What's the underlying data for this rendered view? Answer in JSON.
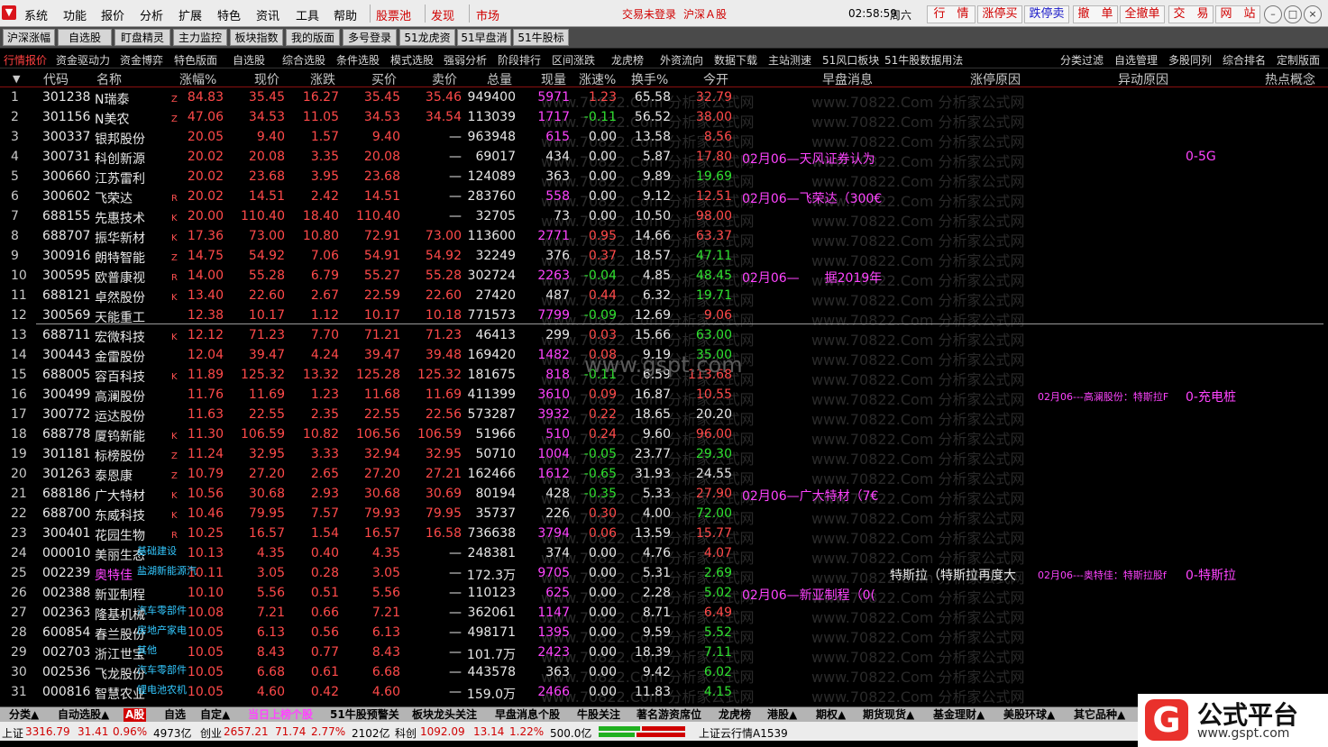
{
  "menu": {
    "items": [
      "系统",
      "功能",
      "报价",
      "分析",
      "扩展",
      "特色",
      "资讯",
      "工具",
      "帮助"
    ],
    "stock_pool": "股票池",
    "discover": "发现",
    "market": "市场",
    "login_status": "交易未登录",
    "market_name": "沪深Ａ股",
    "time": "02:58:59",
    "weekday": "周六",
    "quick_buttons": [
      "行　情",
      "涨停买",
      "跌停卖",
      "撤　单",
      "全撤单",
      "交　易",
      "网　站"
    ],
    "win_min": "–",
    "win_restore": "□",
    "win_close": "×"
  },
  "toolbar": [
    "沪深涨幅",
    "自选股",
    "盯盘精灵",
    "主力监控",
    "板块指数",
    "我的版面",
    "多号登录",
    "51龙虎资金",
    "51早盘消息",
    "51牛股标签"
  ],
  "subtabs": [
    "行情报价",
    "资金驱动力",
    "资金博弈",
    "特色版面",
    "自选股",
    "综合选股",
    "条件选股",
    "模式选股",
    "强弱分析",
    "阶段排行",
    "区间涨跌",
    "龙虎榜",
    "外资流向",
    "数据下载",
    "主站测速",
    "51风口板块",
    "51牛股数据用法",
    "分类过滤",
    "自选管理",
    "多股同列",
    "综合排名",
    "定制版面"
  ],
  "columns": [
    "代码",
    "名称",
    "涨幅%",
    "现价",
    "涨跌",
    "买价",
    "卖价",
    "总量",
    "现量",
    "涨速%",
    "换手%",
    "今开",
    "早盘消息",
    "涨停原因",
    "异动原因",
    "热点概念"
  ],
  "rows": [
    {
      "idx": "1",
      "code": "301238",
      "name": "N瑞泰",
      "flag": "Z",
      "chg_pct": "84.83",
      "price": "35.45",
      "chg": "16.27",
      "bid": "35.45",
      "ask": "35.46",
      "vol": "949400",
      "cur": "5971",
      "cur_c": "mag",
      "speed": "1.23",
      "speed_c": "red",
      "turn": "65.58",
      "open": "32.79",
      "open_c": "red"
    },
    {
      "idx": "2",
      "code": "301156",
      "name": "N美农",
      "flag": "Z",
      "chg_pct": "47.06",
      "price": "34.53",
      "chg": "11.05",
      "bid": "34.53",
      "ask": "34.54",
      "vol": "113039",
      "cur": "1717",
      "cur_c": "mag",
      "speed": "-0.11",
      "speed_c": "green",
      "turn": "56.52",
      "open": "38.00",
      "open_c": "red"
    },
    {
      "idx": "3",
      "code": "300337",
      "name": "银邦股份",
      "flag": "",
      "chg_pct": "20.05",
      "price": "9.40",
      "chg": "1.57",
      "bid": "9.40",
      "ask": "—",
      "vol": "963948",
      "cur": "615",
      "cur_c": "mag",
      "speed": "0.00",
      "speed_c": "white",
      "turn": "13.58",
      "open": "8.56",
      "open_c": "red"
    },
    {
      "idx": "4",
      "code": "300731",
      "name": "科创新源",
      "flag": "",
      "chg_pct": "20.02",
      "price": "20.08",
      "chg": "3.35",
      "bid": "20.08",
      "ask": "—",
      "vol": "69017",
      "cur": "434",
      "cur_c": "white",
      "speed": "0.00",
      "speed_c": "white",
      "turn": "5.87",
      "open": "17.80",
      "open_c": "red",
      "news": "02月06—天风证券认为",
      "concept": "0-5G"
    },
    {
      "idx": "5",
      "code": "300660",
      "name": "江苏雷利",
      "flag": "",
      "chg_pct": "20.02",
      "price": "23.68",
      "chg": "3.95",
      "bid": "23.68",
      "ask": "—",
      "vol": "124089",
      "cur": "363",
      "cur_c": "white",
      "speed": "0.00",
      "speed_c": "white",
      "turn": "9.89",
      "open": "19.69",
      "open_c": "green"
    },
    {
      "idx": "6",
      "code": "300602",
      "name": "飞荣达",
      "flag": "R",
      "chg_pct": "20.02",
      "price": "14.51",
      "chg": "2.42",
      "bid": "14.51",
      "ask": "—",
      "vol": "283760",
      "cur": "558",
      "cur_c": "mag",
      "speed": "0.00",
      "speed_c": "white",
      "turn": "9.12",
      "open": "12.51",
      "open_c": "red",
      "news": "02月06—飞荣达（300€"
    },
    {
      "idx": "7",
      "code": "688155",
      "name": "先惠技术",
      "flag": "K",
      "chg_pct": "20.00",
      "price": "110.40",
      "chg": "18.40",
      "bid": "110.40",
      "ask": "—",
      "vol": "32705",
      "cur": "73",
      "cur_c": "white",
      "speed": "0.00",
      "speed_c": "white",
      "turn": "10.50",
      "open": "98.00",
      "open_c": "red"
    },
    {
      "idx": "8",
      "code": "688707",
      "name": "振华新材",
      "flag": "K",
      "chg_pct": "17.36",
      "price": "73.00",
      "chg": "10.80",
      "bid": "72.91",
      "ask": "73.00",
      "vol": "113600",
      "cur": "2771",
      "cur_c": "mag",
      "speed": "0.95",
      "speed_c": "red",
      "turn": "14.66",
      "open": "63.37",
      "open_c": "red"
    },
    {
      "idx": "9",
      "code": "300916",
      "name": "朗特智能",
      "flag": "Z",
      "chg_pct": "14.75",
      "price": "54.92",
      "chg": "7.06",
      "bid": "54.91",
      "ask": "54.92",
      "vol": "32249",
      "cur": "376",
      "cur_c": "white",
      "speed": "0.37",
      "speed_c": "red",
      "turn": "18.57",
      "open": "47.11",
      "open_c": "green"
    },
    {
      "idx": "10",
      "code": "300595",
      "name": "欧普康视",
      "flag": "R",
      "chg_pct": "14.00",
      "price": "55.28",
      "chg": "6.79",
      "bid": "55.27",
      "ask": "55.28",
      "vol": "302724",
      "cur": "2263",
      "cur_c": "mag",
      "speed": "-0.04",
      "speed_c": "green",
      "turn": "4.85",
      "open": "48.45",
      "open_c": "green",
      "news": "02月06—　　据2019年"
    },
    {
      "idx": "11",
      "code": "688121",
      "name": "卓然股份",
      "flag": "K",
      "chg_pct": "13.40",
      "price": "22.60",
      "chg": "2.67",
      "bid": "22.59",
      "ask": "22.60",
      "vol": "27420",
      "cur": "487",
      "cur_c": "white",
      "speed": "0.44",
      "speed_c": "red",
      "turn": "6.32",
      "open": "19.71",
      "open_c": "green"
    },
    {
      "idx": "12",
      "code": "300569",
      "name": "天能重工",
      "flag": "",
      "chg_pct": "12.38",
      "price": "10.17",
      "chg": "1.12",
      "bid": "10.17",
      "ask": "10.18",
      "vol": "771573",
      "cur": "7799",
      "cur_c": "mag",
      "speed": "-0.09",
      "speed_c": "green",
      "turn": "12.69",
      "open": "9.06",
      "open_c": "red"
    },
    {
      "idx": "13",
      "code": "688711",
      "name": "宏微科技",
      "flag": "K",
      "chg_pct": "12.12",
      "price": "71.23",
      "chg": "7.70",
      "bid": "71.21",
      "ask": "71.23",
      "vol": "46413",
      "cur": "299",
      "cur_c": "white",
      "speed": "0.03",
      "speed_c": "red",
      "turn": "15.66",
      "open": "63.00",
      "open_c": "green"
    },
    {
      "idx": "14",
      "code": "300443",
      "name": "金雷股份",
      "flag": "",
      "chg_pct": "12.04",
      "price": "39.47",
      "chg": "4.24",
      "bid": "39.47",
      "ask": "39.48",
      "vol": "169420",
      "cur": "1482",
      "cur_c": "mag",
      "speed": "0.08",
      "speed_c": "red",
      "turn": "9.19",
      "open": "35.00",
      "open_c": "green"
    },
    {
      "idx": "15",
      "code": "688005",
      "name": "容百科技",
      "flag": "K",
      "chg_pct": "11.89",
      "price": "125.32",
      "chg": "13.32",
      "bid": "125.28",
      "ask": "125.32",
      "vol": "181675",
      "cur": "818",
      "cur_c": "mag",
      "speed": "-0.11",
      "speed_c": "green",
      "turn": "6.59",
      "open": "113.68",
      "open_c": "red"
    },
    {
      "idx": "16",
      "code": "300499",
      "name": "高澜股份",
      "flag": "",
      "chg_pct": "11.76",
      "price": "11.69",
      "chg": "1.23",
      "bid": "11.68",
      "ask": "11.69",
      "vol": "411399",
      "cur": "3610",
      "cur_c": "mag",
      "speed": "0.09",
      "speed_c": "red",
      "turn": "16.87",
      "open": "10.55",
      "open_c": "red",
      "anomaly": "02月06---高澜股份：特斯拉F",
      "concept": "0-充电桩"
    },
    {
      "idx": "17",
      "code": "300772",
      "name": "运达股份",
      "flag": "",
      "chg_pct": "11.63",
      "price": "22.55",
      "chg": "2.35",
      "bid": "22.55",
      "ask": "22.56",
      "vol": "573287",
      "cur": "3932",
      "cur_c": "mag",
      "speed": "0.22",
      "speed_c": "red",
      "turn": "18.65",
      "open": "20.20",
      "open_c": "white"
    },
    {
      "idx": "18",
      "code": "688778",
      "name": "厦钨新能",
      "flag": "K",
      "chg_pct": "11.30",
      "price": "106.59",
      "chg": "10.82",
      "bid": "106.56",
      "ask": "106.59",
      "vol": "51966",
      "cur": "510",
      "cur_c": "mag",
      "speed": "0.24",
      "speed_c": "red",
      "turn": "9.60",
      "open": "96.00",
      "open_c": "red"
    },
    {
      "idx": "19",
      "code": "301181",
      "name": "标榜股份",
      "flag": "Z",
      "chg_pct": "11.24",
      "price": "32.95",
      "chg": "3.33",
      "bid": "32.94",
      "ask": "32.95",
      "vol": "50710",
      "cur": "1004",
      "cur_c": "mag",
      "speed": "-0.05",
      "speed_c": "green",
      "turn": "23.77",
      "open": "29.30",
      "open_c": "green"
    },
    {
      "idx": "20",
      "code": "301263",
      "name": "泰恩康",
      "flag": "Z",
      "chg_pct": "10.79",
      "price": "27.20",
      "chg": "2.65",
      "bid": "27.20",
      "ask": "27.21",
      "vol": "162466",
      "cur": "1612",
      "cur_c": "mag",
      "speed": "-0.65",
      "speed_c": "green",
      "turn": "31.93",
      "open": "24.55",
      "open_c": "white"
    },
    {
      "idx": "21",
      "code": "688186",
      "name": "广大特材",
      "flag": "K",
      "chg_pct": "10.56",
      "price": "30.68",
      "chg": "2.93",
      "bid": "30.68",
      "ask": "30.69",
      "vol": "80194",
      "cur": "428",
      "cur_c": "white",
      "speed": "-0.35",
      "speed_c": "green",
      "turn": "5.33",
      "open": "27.90",
      "open_c": "red",
      "news": "02月06—广大特材（7€"
    },
    {
      "idx": "22",
      "code": "688700",
      "name": "东威科技",
      "flag": "K",
      "chg_pct": "10.46",
      "price": "79.95",
      "chg": "7.57",
      "bid": "79.93",
      "ask": "79.95",
      "vol": "35737",
      "cur": "226",
      "cur_c": "white",
      "speed": "0.30",
      "speed_c": "red",
      "turn": "4.00",
      "open": "72.00",
      "open_c": "green"
    },
    {
      "idx": "23",
      "code": "300401",
      "name": "花园生物",
      "flag": "R",
      "chg_pct": "10.25",
      "price": "16.57",
      "chg": "1.54",
      "bid": "16.57",
      "ask": "16.58",
      "vol": "736638",
      "cur": "3794",
      "cur_c": "mag",
      "speed": "0.06",
      "speed_c": "red",
      "turn": "13.59",
      "open": "15.77",
      "open_c": "red"
    },
    {
      "idx": "24",
      "code": "000010",
      "name": "美丽生态",
      "flag": "",
      "tag": "基础建设",
      "chg_pct": "10.13",
      "price": "4.35",
      "chg": "0.40",
      "bid": "4.35",
      "ask": "—",
      "vol": "248381",
      "cur": "374",
      "cur_c": "white",
      "speed": "0.00",
      "speed_c": "white",
      "turn": "4.76",
      "open": "4.07",
      "open_c": "red"
    },
    {
      "idx": "25",
      "code": "002239",
      "name": "奥特佳",
      "flag": "",
      "tag": "盐湖新能源汽",
      "name_c": "pinkname",
      "chg_pct": "10.11",
      "price": "3.05",
      "chg": "0.28",
      "bid": "3.05",
      "ask": "—",
      "vol": "172.3万",
      "cur": "9705",
      "cur_c": "mag",
      "speed": "0.00",
      "speed_c": "white",
      "turn": "5.31",
      "open": "2.69",
      "open_c": "green",
      "cause": "特斯拉（特斯拉再度大",
      "anomaly": "02月06---奥特佳：特斯拉股f",
      "concept": "0-特斯拉"
    },
    {
      "idx": "26",
      "code": "002388",
      "name": "新亚制程",
      "flag": "",
      "chg_pct": "10.10",
      "price": "5.56",
      "chg": "0.51",
      "bid": "5.56",
      "ask": "—",
      "vol": "110123",
      "cur": "625",
      "cur_c": "mag",
      "speed": "0.00",
      "speed_c": "white",
      "turn": "2.28",
      "open": "5.02",
      "open_c": "green",
      "news": "02月06—新亚制程（0("
    },
    {
      "idx": "27",
      "code": "002363",
      "name": "隆基机械",
      "flag": "",
      "tag": "汽车零部件",
      "chg_pct": "10.08",
      "price": "7.21",
      "chg": "0.66",
      "bid": "7.21",
      "ask": "—",
      "vol": "362061",
      "cur": "1147",
      "cur_c": "mag",
      "speed": "0.00",
      "speed_c": "white",
      "turn": "8.71",
      "open": "6.49",
      "open_c": "red"
    },
    {
      "idx": "28",
      "code": "600854",
      "name": "春兰股份",
      "flag": "",
      "tag": "房地产家电",
      "chg_pct": "10.05",
      "price": "6.13",
      "chg": "0.56",
      "bid": "6.13",
      "ask": "—",
      "vol": "498171",
      "cur": "1395",
      "cur_c": "mag",
      "speed": "0.00",
      "speed_c": "white",
      "turn": "9.59",
      "open": "5.52",
      "open_c": "green"
    },
    {
      "idx": "29",
      "code": "002703",
      "name": "浙江世宝",
      "flag": "",
      "tag": "其他",
      "chg_pct": "10.05",
      "price": "8.43",
      "chg": "0.77",
      "bid": "8.43",
      "ask": "—",
      "vol": "101.7万",
      "cur": "2423",
      "cur_c": "mag",
      "speed": "0.00",
      "speed_c": "white",
      "turn": "18.39",
      "open": "7.11",
      "open_c": "green"
    },
    {
      "idx": "30",
      "code": "002536",
      "name": "飞龙股份",
      "flag": "",
      "tag": "汽车零部件",
      "chg_pct": "10.05",
      "price": "6.68",
      "chg": "0.61",
      "bid": "6.68",
      "ask": "—",
      "vol": "443578",
      "cur": "363",
      "cur_c": "white",
      "speed": "0.00",
      "speed_c": "white",
      "turn": "9.42",
      "open": "6.02",
      "open_c": "green"
    },
    {
      "idx": "31",
      "code": "000816",
      "name": "智慧农业",
      "flag": "",
      "tag": "锂电池农机",
      "chg_pct": "10.05",
      "price": "4.60",
      "chg": "0.42",
      "bid": "4.60",
      "ask": "—",
      "vol": "159.0万",
      "cur": "2466",
      "cur_c": "mag",
      "speed": "0.00",
      "speed_c": "white",
      "turn": "11.83",
      "open": "4.15",
      "open_c": "green"
    }
  ],
  "watermark": "www.70822.Com 分析家公式网",
  "center_watermark": "www.gspt.com",
  "bottom_tabs": [
    "分类▲",
    "自动选股▲",
    "A股",
    "自选",
    "自定▲",
    "当日上榜个股",
    "51牛股预警关",
    "板块龙头关注",
    "早盘消息个股",
    "牛股关注",
    "著名游资席位",
    "龙虎榜",
    "港股▲",
    "期权▲",
    "期货现货▲",
    "基金理财▲",
    "美股环球▲",
    "其它品种▲"
  ],
  "status": {
    "sh_label": "上证",
    "sh_val": "3316.79",
    "sh_chg": "31.41",
    "sh_pct": "0.96%",
    "sh_amt": "4973亿",
    "cy_label": "创业",
    "cy_val": "2657.21",
    "cy_chg": "71.74",
    "cy_pct": "2.77%",
    "cy_amt": "2102亿",
    "kc_label": "科创",
    "kc_val": "1092.09",
    "kc_chg": "13.14",
    "kc_pct": "1.22%",
    "kc_amt": "500.0亿",
    "server": "上证云行情A1539"
  },
  "brand": {
    "letter": "G",
    "name": "公式平台",
    "url": "www.gspt.com"
  }
}
